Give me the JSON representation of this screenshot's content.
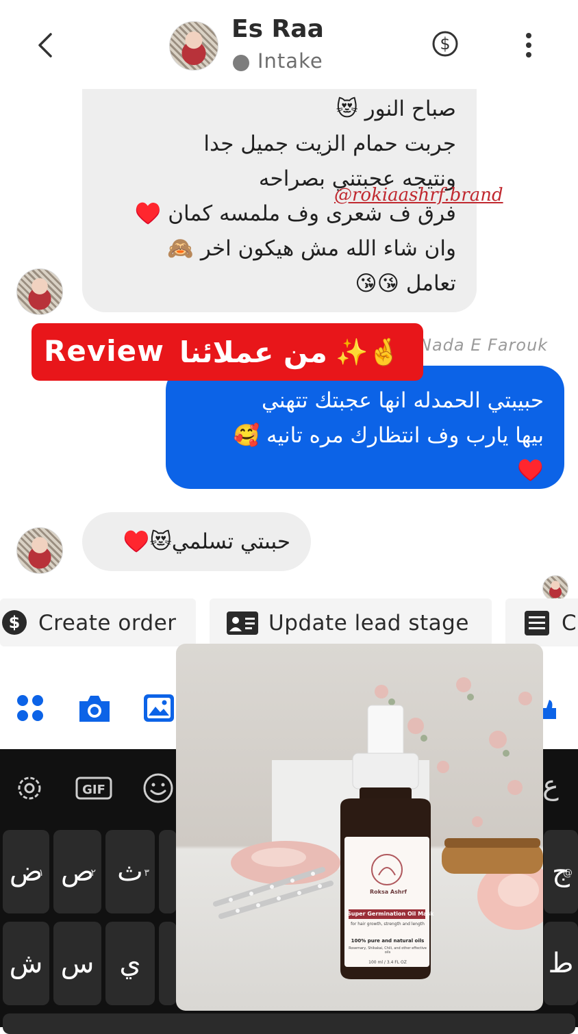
{
  "header": {
    "contact_name": "Es Raa",
    "status": "Intake"
  },
  "messages": [
    {
      "from": "contact",
      "lines": [
        "صباح النور 😻",
        "جربت حمام الزيت جميل جدا",
        "ونتيجه عجبتني بصراحه",
        "فرق ف شعرى وف ملمسه كمان ♥️",
        "وان شاء الله مش هيكون اخر 🙈",
        "تعامل 😘😘"
      ]
    },
    {
      "from": "me",
      "sender": "Nada E Farouk",
      "lines": [
        "حبيبتي الحمدله انها عجبتك تتهني",
        "بيها يارب وف انتظارك مره تانيه 🥰",
        "♥️"
      ]
    },
    {
      "from": "contact",
      "lines": [
        "حبىتي تسلمي😻♥️"
      ]
    }
  ],
  "overlay": {
    "watermark": "@rokiaashrf.brand",
    "review_en": "Review",
    "review_ar": "من عملائنا",
    "review_emoji": "✨🤞"
  },
  "quick_actions": [
    {
      "label": "Create order",
      "icon": "dollar-icon"
    },
    {
      "label": "Update lead stage",
      "icon": "contact-card-icon"
    },
    {
      "label": "C",
      "icon": "list-icon"
    }
  ],
  "composer": {
    "icons": [
      "apps-icon",
      "camera-icon",
      "gallery-icon"
    ]
  },
  "keyboard": {
    "toolbar": [
      "settings-icon",
      "GIF",
      "emoji-icon"
    ],
    "row1": [
      {
        "ch": "ض",
        "num": "١"
      },
      {
        "ch": "ص",
        "num": "٢"
      },
      {
        "ch": "ث",
        "num": "٣"
      }
    ],
    "row1_right": {
      "ch": "ج",
      "num": "@"
    },
    "row2": [
      "ش",
      "س",
      "ي"
    ],
    "row2_right": "ط",
    "toolbar_right": "ع"
  },
  "product": {
    "brand": "Roksa Ashrf",
    "name": "Super Germination Oil Mask",
    "tagline": "for hair growth, strength and length",
    "claim": "100% pure and natural oils",
    "ingredients": "Rosemary, Shikakai, Chili, and other effective oils",
    "volume": "100 ml / 3.4 FL OZ"
  },
  "colors": {
    "primary_blue": "#0c63e7",
    "incoming_bubble": "#eeeeee",
    "review_red": "#e8161a"
  }
}
